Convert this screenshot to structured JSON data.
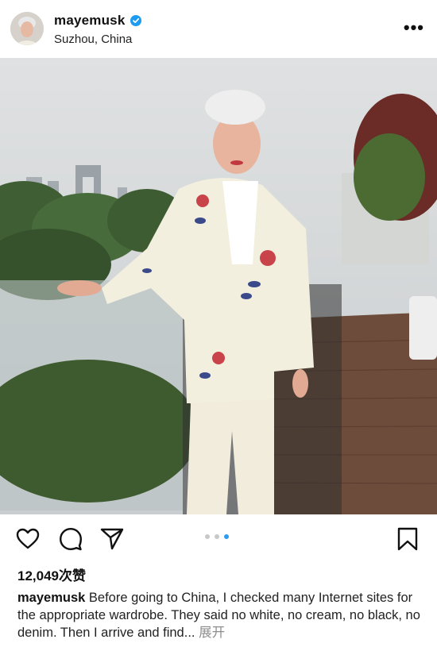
{
  "post": {
    "username": "mayemusk",
    "location": "Suzhou, China",
    "likes_label": "12,049次赞",
    "caption_user": "mayemusk",
    "caption_text": " Before going to China, I checked many Internet sites for the appropriate wardrobe. They said no white, no cream, no black, no denim. Then I arrive and find... ",
    "expand_label": "展开",
    "carousel": {
      "count": 3,
      "active": 3
    }
  },
  "icons": {
    "verified": "verified-badge-icon",
    "more": "more-options-icon",
    "like": "heart-icon",
    "comment": "comment-icon",
    "share": "paper-plane-icon",
    "save": "bookmark-icon"
  },
  "colors": {
    "verified": "#1d9bf0",
    "active_dot": "#2e9bf0"
  }
}
